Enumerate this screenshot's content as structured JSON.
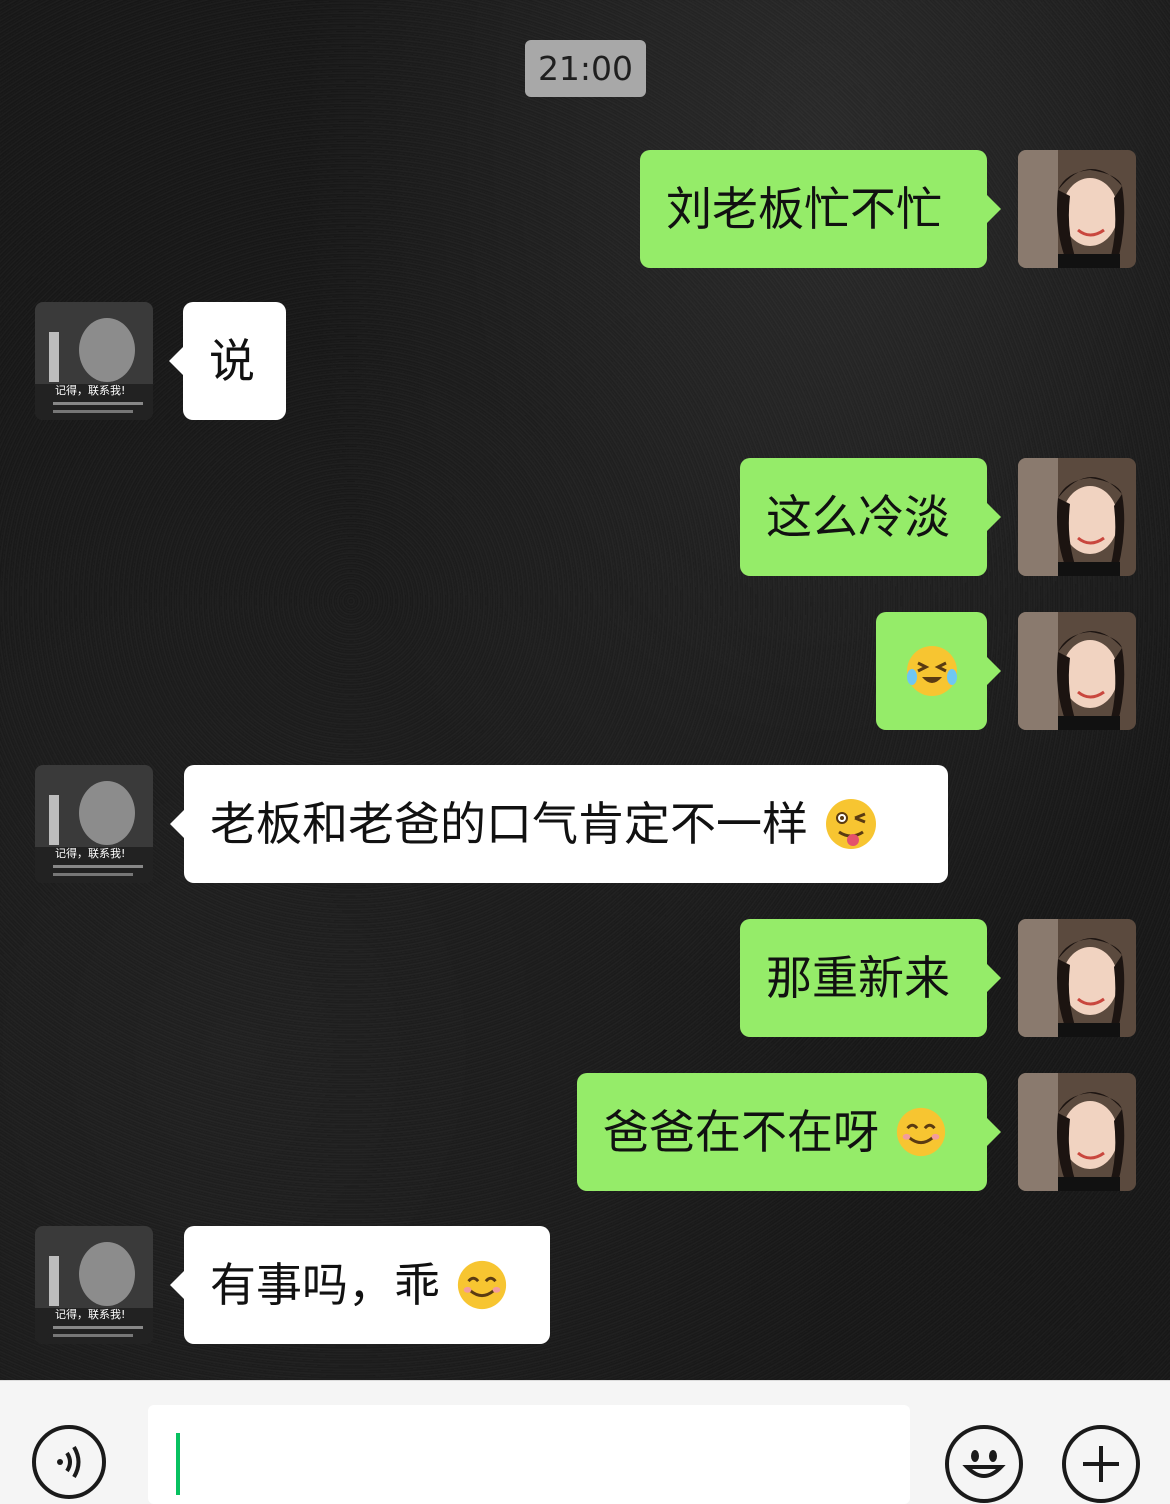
{
  "chat": {
    "timestamp": "21:00",
    "messages": [
      {
        "sender": "me",
        "text": "刘老板忙不忙"
      },
      {
        "sender": "other",
        "text": "说"
      },
      {
        "sender": "me",
        "text": "这么冷淡"
      },
      {
        "sender": "me",
        "text": "",
        "emoji": "laughing-crying-emoji"
      },
      {
        "sender": "other",
        "text": "老板和老爸的口气肯定不一样",
        "emoji": "wink-tongue-emoji"
      },
      {
        "sender": "me",
        "text": "那重新来"
      },
      {
        "sender": "me",
        "text": "爸爸在不在呀",
        "emoji": "smile-emoji"
      },
      {
        "sender": "other",
        "text": "有事吗，乖",
        "emoji": "smile-emoji"
      }
    ]
  },
  "avatars": {
    "other": {
      "caption": "记得，联系我!"
    }
  },
  "input_bar": {
    "value": "",
    "icons": {
      "voice": "voice-icon",
      "emoji": "emoji-icon",
      "more": "plus-icon"
    }
  },
  "colors": {
    "my_bubble": "#95ec69",
    "other_bubble": "#ffffff",
    "timestamp_bg": "#a8a8a8",
    "cursor": "#07c160"
  }
}
